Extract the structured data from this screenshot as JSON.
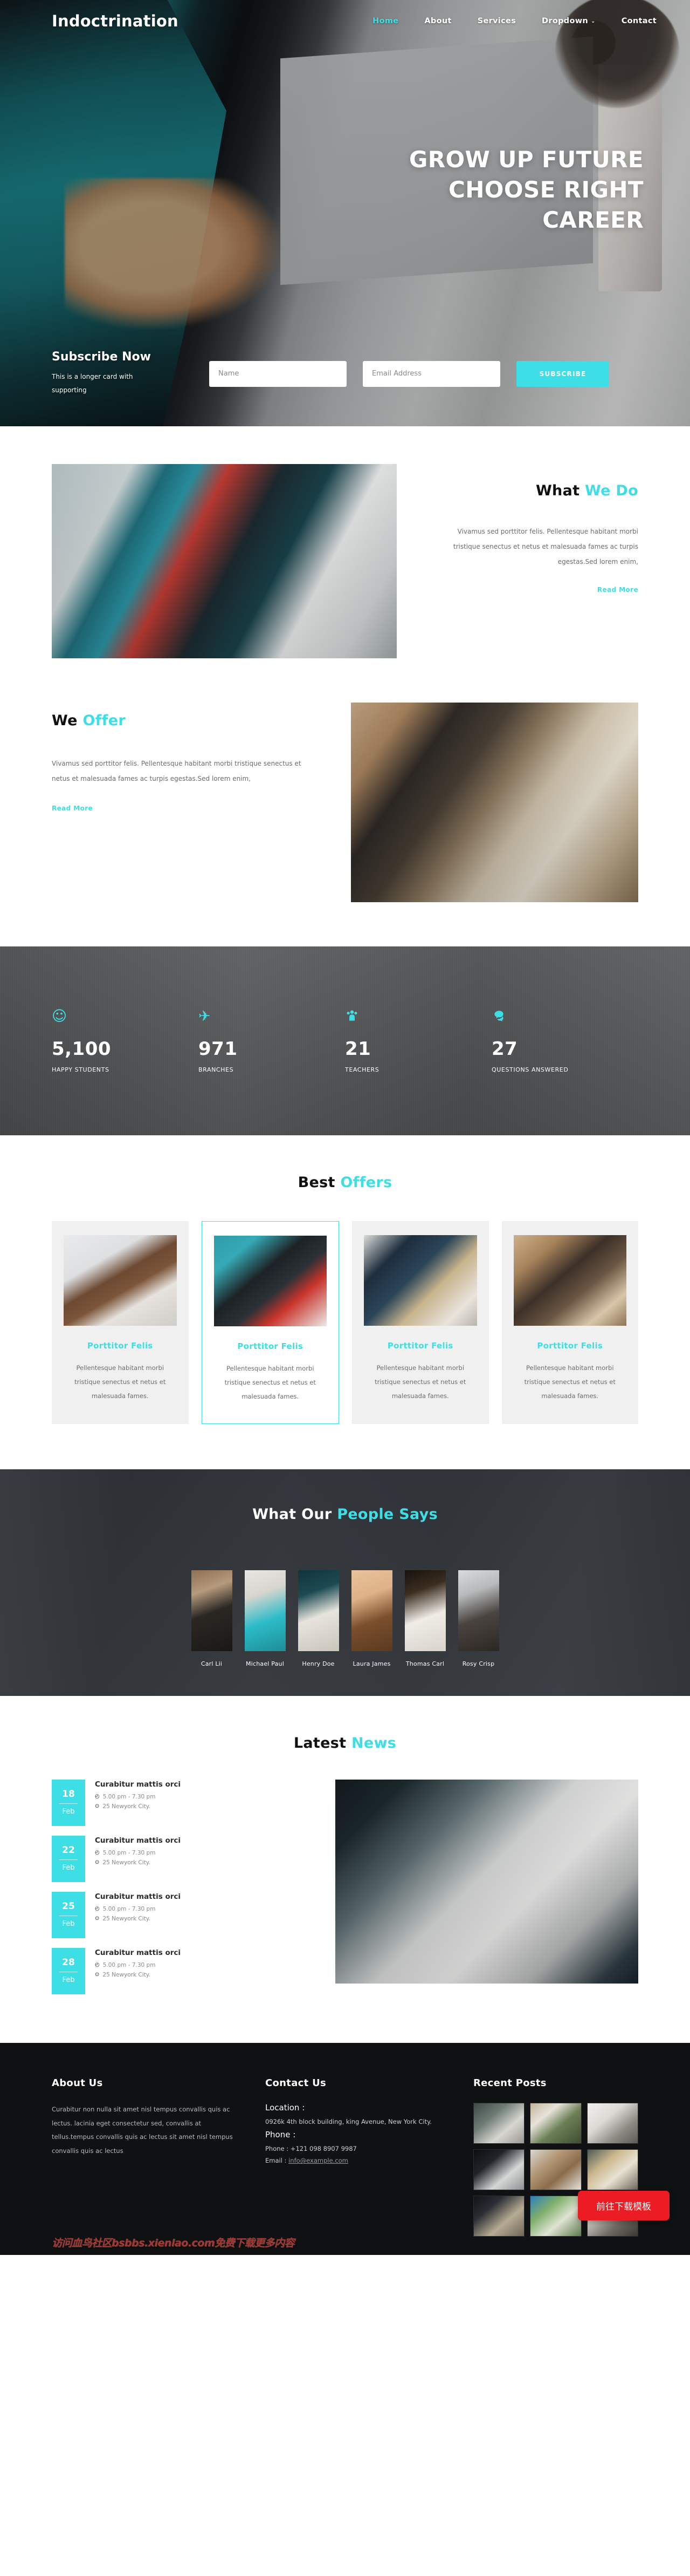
{
  "brand": "Indoctrination",
  "nav": {
    "items": [
      {
        "label": "Home",
        "active": true
      },
      {
        "label": "About",
        "active": false
      },
      {
        "label": "Services",
        "active": false
      },
      {
        "label": "Dropdown",
        "active": false,
        "caret": "⌄"
      },
      {
        "label": "Contact",
        "active": false
      }
    ]
  },
  "hero": {
    "line1": "GROW UP FUTURE",
    "line2": "CHOOSE RIGHT",
    "line3": "CAREER"
  },
  "subscribe": {
    "title": "Subscribe Now",
    "subtitle": "This is a longer card with supporting",
    "name_placeholder": "Name",
    "name_value": "",
    "email_placeholder": "Email Address",
    "email_value": "",
    "button": "SUBSCRIBE"
  },
  "what_we_do": {
    "head_dark": "What ",
    "head_cyan": "We Do",
    "body": "Vivamus sed porttitor felis. Pellentesque habitant morbi tristique senectus et netus et malesuada fames ac turpis egestas.Sed lorem enim,",
    "read_more": "Read More"
  },
  "we_offer": {
    "head_dark": "We ",
    "head_cyan": "Offer",
    "body": "Vivamus sed porttitor felis. Pellentesque habitant morbi tristique senectus et netus et malesuada fames ac turpis egestas.Sed lorem enim,",
    "read_more": "Read More"
  },
  "counters": [
    {
      "icon": "☺",
      "icon_name": "smiley-icon",
      "number": "5,100",
      "label": "HAPPY STUDENTS"
    },
    {
      "icon": "✈",
      "icon_name": "airplane-icon",
      "number": "971",
      "label": "BRANCHES"
    },
    {
      "icon": "Д",
      "icon_name": "users-icon",
      "number": "21",
      "label": "TEACHERS"
    },
    {
      "icon": "✉",
      "icon_name": "chat-icon",
      "number": "27",
      "label": "QUESTIONS ANSWERED"
    }
  ],
  "best_offers": {
    "head_dark": "Best ",
    "head_cyan": "Offers",
    "cards": [
      {
        "title": "Porttitor Felis",
        "desc": "Pellentesque habitant morbi tristique senectus et netus et malesuada fames.",
        "selected": false
      },
      {
        "title": "Porttitor Felis",
        "desc": "Pellentesque habitant morbi tristique senectus et netus et malesuada fames.",
        "selected": true
      },
      {
        "title": "Porttitor Felis",
        "desc": "Pellentesque habitant morbi tristique senectus et netus et malesuada fames.",
        "selected": false
      },
      {
        "title": "Porttitor Felis",
        "desc": "Pellentesque habitant morbi tristique senectus et netus et malesuada fames.",
        "selected": false
      }
    ]
  },
  "testimonials": {
    "head_white": "What Our ",
    "head_cyan": "People Says",
    "people": [
      {
        "name": "Carl Lii"
      },
      {
        "name": "Michael Paul"
      },
      {
        "name": "Henry Doe"
      },
      {
        "name": "Laura James"
      },
      {
        "name": "Thomas Carl"
      },
      {
        "name": "Rosy Crisp"
      }
    ]
  },
  "latest_news": {
    "head_dark": "Latest ",
    "head_cyan": "News",
    "items": [
      {
        "day": "18",
        "month": "Feb",
        "title": "Curabitur mattis orci",
        "time": "5.00 pm - 7.30 pm",
        "place": "25 Newyork City."
      },
      {
        "day": "22",
        "month": "Feb",
        "title": "Curabitur mattis orci",
        "time": "5.00 pm - 7.30 pm",
        "place": "25 Newyork City."
      },
      {
        "day": "25",
        "month": "Feb",
        "title": "Curabitur mattis orci",
        "time": "5.00 pm - 7.30 pm",
        "place": "25 Newyork City."
      },
      {
        "day": "28",
        "month": "Feb",
        "title": "Curabitur mattis orci",
        "time": "5.00 pm - 7.30 pm",
        "place": "25 Newyork City."
      }
    ],
    "clock_icon": "◴",
    "pin_icon": "⊙"
  },
  "footer": {
    "about_head": "About Us",
    "about_body": "Curabitur non nulla sit amet nisl tempus convallis quis ac lectus. lacinia eget consectetur sed, convallis at tellus.tempus convallis quis ac lectus sit amet nisl tempus convallis quis ac lectus",
    "contact_head": "Contact Us",
    "location_label": "Location :",
    "location_value": "0926k 4th block building, king Avenue, New York City.",
    "phone_label": "Phone :",
    "phone_value": "Phone : +121 098 8907 9987",
    "email_label": "Email : ",
    "email_value": "info@example.com",
    "posts_head": "Recent Posts",
    "cta_button": "前往下载模板",
    "watermark": "访问血鸟社区bsbbs.xienlao.com免费下载更多内容"
  },
  "colors": {
    "accent": "#3ddee6",
    "dark": "#101113",
    "counter_bg": "#4e5052",
    "cta_red": "#ec1c24"
  }
}
